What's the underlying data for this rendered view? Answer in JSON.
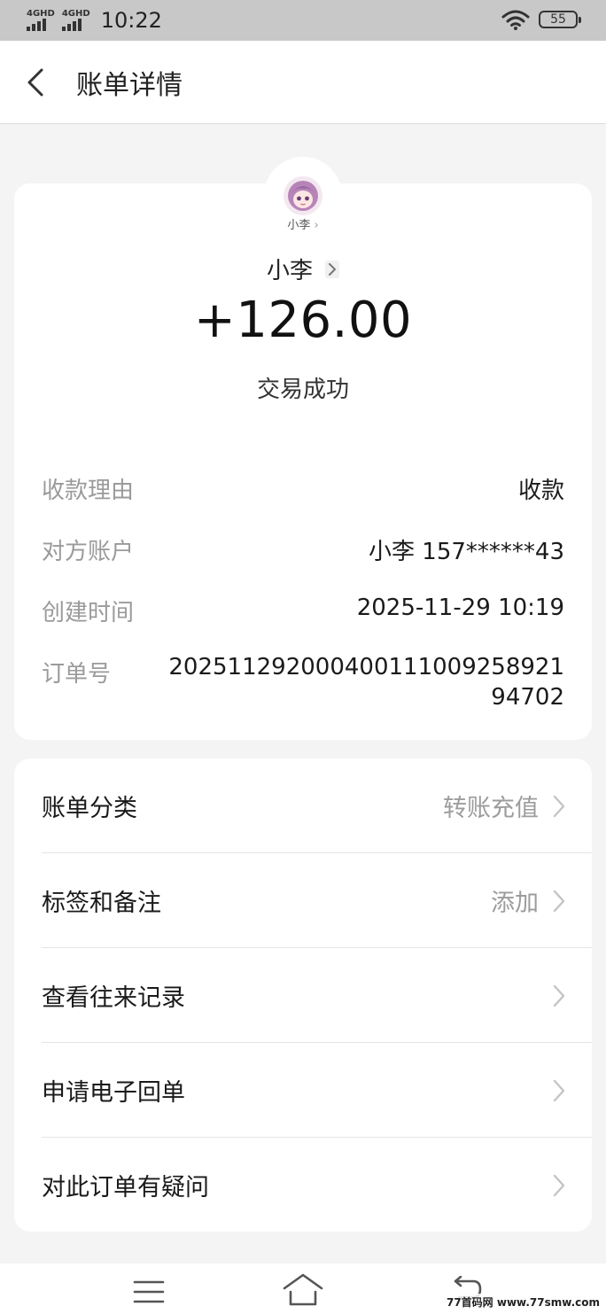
{
  "status_bar": {
    "signal_1": "4GHD",
    "signal_2": "4GHD",
    "time": "10:22",
    "battery": "55"
  },
  "header": {
    "title": "账单详情"
  },
  "summary": {
    "avatar_caption": "小李",
    "payee_name": "小李",
    "amount": "+126.00",
    "status": "交易成功"
  },
  "details": [
    {
      "label": "收款理由",
      "value": "收款"
    },
    {
      "label": "对方账户",
      "value": "小李 157******43"
    },
    {
      "label": "创建时间",
      "value": "2025-11-29 10:19"
    },
    {
      "label": "订单号",
      "value": "20251129200040011100925892194702"
    }
  ],
  "menu": [
    {
      "label": "账单分类",
      "value": "转账充值"
    },
    {
      "label": "标签和备注",
      "value": "添加"
    },
    {
      "label": "查看往来记录",
      "value": ""
    },
    {
      "label": "申请电子回单",
      "value": ""
    },
    {
      "label": "对此订单有疑问",
      "value": ""
    }
  ],
  "watermark": "77首码网  www.77smw.com",
  "icons": {
    "back": "chevron-left-icon",
    "row_arrow": "chevron-right-icon",
    "nav_menu": "menu-icon",
    "nav_home": "home-icon",
    "nav_back": "back-icon",
    "wifi": "wifi-icon"
  }
}
